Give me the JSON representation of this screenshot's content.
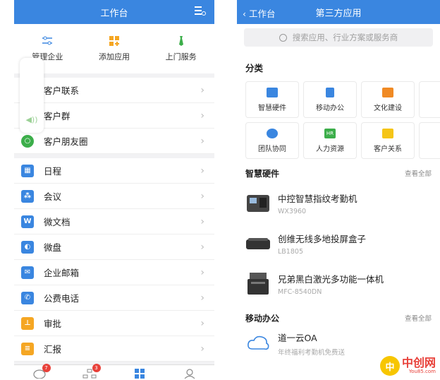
{
  "left": {
    "title": "工作台",
    "quick": [
      {
        "label": "管理企业",
        "icon": "sliders-icon"
      },
      {
        "label": "添加应用",
        "icon": "grid-plus-icon"
      },
      {
        "label": "上门服务",
        "icon": "tie-icon"
      }
    ],
    "group1": [
      {
        "label": "客户联系",
        "icon": "contact-icon",
        "color": "#2f9be8"
      },
      {
        "label": "客户群",
        "icon": "group-icon",
        "color": "#2f9be8"
      },
      {
        "label": "客户朋友圈",
        "icon": "moments-icon",
        "color": "#3cae4a"
      }
    ],
    "group2": [
      {
        "label": "日程",
        "icon": "calendar-icon",
        "color": "#3a86e0"
      },
      {
        "label": "会议",
        "icon": "meeting-icon",
        "color": "#3a86e0"
      },
      {
        "label": "微文档",
        "icon": "doc-icon",
        "color": "#3a86e0"
      },
      {
        "label": "微盘",
        "icon": "disk-icon",
        "color": "#3a86e0"
      },
      {
        "label": "企业邮箱",
        "icon": "mail-icon",
        "color": "#3a86e0"
      },
      {
        "label": "公费电话",
        "icon": "phone-icon",
        "color": "#3a86e0"
      },
      {
        "label": "审批",
        "icon": "approve-icon",
        "color": "#f5a623"
      },
      {
        "label": "汇报",
        "icon": "report-icon",
        "color": "#f5a623"
      }
    ],
    "tabs": {
      "messages_badge": "7",
      "contacts_badge": "3"
    }
  },
  "right": {
    "back_label": "工作台",
    "title": "第三方应用",
    "search_placeholder": "搜索应用、行业方案或服务商",
    "category_title": "分类",
    "categories": [
      {
        "label": "智慧硬件",
        "color": "#3a86e0"
      },
      {
        "label": "移动办公",
        "color": "#3a86e0"
      },
      {
        "label": "文化建设",
        "color": "#f08a24"
      },
      {
        "label": "表",
        "color": "#3a86e0"
      },
      {
        "label": "团队协同",
        "color": "#3a86e0"
      },
      {
        "label": "人力资源",
        "color": "#3cae4a",
        "tag": "HR"
      },
      {
        "label": "客户关系",
        "color": "#f5c518"
      },
      {
        "label": "数",
        "color": "#3a86e0"
      }
    ],
    "hardware": {
      "title": "智慧硬件",
      "more": "查看全部",
      "items": [
        {
          "name": "中控智慧指纹考勤机",
          "model": "WX3960"
        },
        {
          "name": "创维无线多地投屏盒子",
          "model": "LB1805"
        },
        {
          "name": "兄弟黑白激光多功能一体机",
          "model": "MFC-8540DN"
        }
      ]
    },
    "mobile": {
      "title": "移动办公",
      "more": "查看全部",
      "items": [
        {
          "name": "道一云OA",
          "desc": "年终福利考勤机免费送"
        }
      ]
    },
    "watermark": {
      "logo": "中",
      "text": "中创网",
      "url": "You85.com"
    }
  }
}
